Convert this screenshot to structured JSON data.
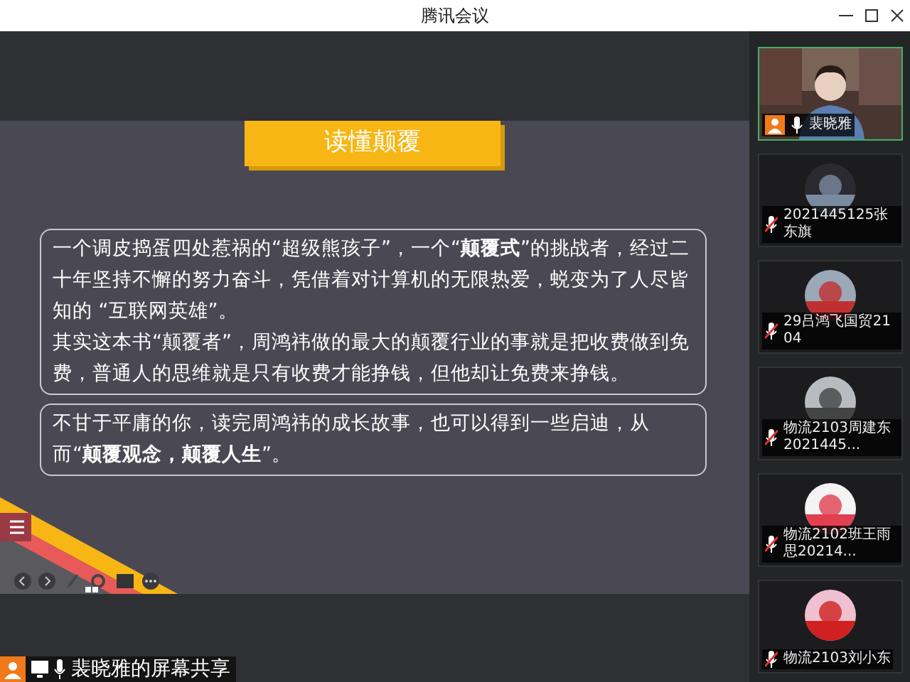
{
  "window": {
    "title": "腾讯会议"
  },
  "slide": {
    "title": "读懂颠覆",
    "boxes": [
      {
        "paragraphs": [
          "一个调皮捣蛋四处惹祸的“超级熊孩子”，一个“**颠覆式**”的挑战者，经过二十年坚持不懈的努力奋斗，凭借着对计算机的无限热爱，蜕变为了人尽皆知的 “互联网英雄”。",
          "其实这本书“颠覆者”，周鸿祎做的最大的颠覆行业的事就是把收费做到免费，普通人的思维就是只有收费才能挣钱，但他却让免费来挣钱。"
        ]
      },
      {
        "paragraphs": [
          "不甘于平庸的你，读完周鸿祎的成长故事，也可以得到一些启迪，从而“**颠覆观念，颠覆人生**”。"
        ]
      }
    ]
  },
  "participants": [
    {
      "name": "裴晓雅",
      "kind": "video",
      "muted": false,
      "selected": true
    },
    {
      "name": "2021445125张东旗",
      "kind": "avatar",
      "muted": true,
      "selected": false
    },
    {
      "name": "29吕鸿飞国贸2104",
      "kind": "avatar",
      "muted": true,
      "selected": false
    },
    {
      "name": "物流2103周建东2021445...",
      "kind": "avatar",
      "muted": true,
      "selected": false
    },
    {
      "name": "物流2102班王雨思20214...",
      "kind": "avatar",
      "muted": true,
      "selected": false
    },
    {
      "name": "物流2103刘小东",
      "kind": "avatar",
      "muted": true,
      "selected": false
    }
  ],
  "status": {
    "label": "裴晓雅的屏幕共享"
  }
}
